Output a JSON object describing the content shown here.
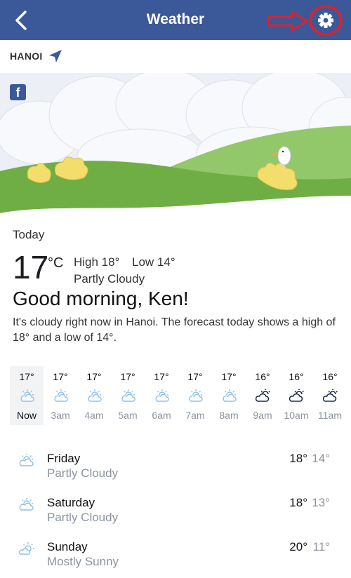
{
  "header": {
    "title": "Weather",
    "back_icon": "back-chevron-icon",
    "settings_icon": "gear-icon"
  },
  "location": {
    "name": "HANOI",
    "icon": "location-arrow-icon"
  },
  "current": {
    "label": "Today",
    "temp": "17",
    "unit": "°C",
    "high": "High 18°",
    "low": "Low 14°",
    "condition": "Partly Cloudy",
    "greeting": "Good morning, Ken!",
    "summary": "It's cloudy right now in Hanoi. The forecast today shows a high of 18° and a low of 14°."
  },
  "hourly": [
    {
      "temp": "17°",
      "label": "Now",
      "icon": "partly-cloudy-icon"
    },
    {
      "temp": "17°",
      "label": "3am",
      "icon": "partly-cloudy-icon"
    },
    {
      "temp": "17°",
      "label": "4am",
      "icon": "partly-cloudy-icon"
    },
    {
      "temp": "17°",
      "label": "5am",
      "icon": "partly-cloudy-icon"
    },
    {
      "temp": "17°",
      "label": "6am",
      "icon": "partly-cloudy-icon"
    },
    {
      "temp": "17°",
      "label": "7am",
      "icon": "partly-cloudy-icon"
    },
    {
      "temp": "17°",
      "label": "8am",
      "icon": "partly-cloudy-icon"
    },
    {
      "temp": "16°",
      "label": "9am",
      "icon": "cloudy-day-icon"
    },
    {
      "temp": "16°",
      "label": "10am",
      "icon": "cloudy-day-icon"
    },
    {
      "temp": "16°",
      "label": "11am",
      "icon": "cloudy-day-icon"
    }
  ],
  "daily": [
    {
      "day": "Friday",
      "condition": "Partly Cloudy",
      "high": "18°",
      "low": "14°",
      "icon": "partly-cloudy-icon"
    },
    {
      "day": "Saturday",
      "condition": "Partly Cloudy",
      "high": "18°",
      "low": "13°",
      "icon": "partly-cloudy-icon"
    },
    {
      "day": "Sunday",
      "condition": "Mostly Sunny",
      "high": "20°",
      "low": "11°",
      "icon": "mostly-sunny-icon"
    }
  ],
  "colors": {
    "header_bg": "#3b5998",
    "annotation": "#e0202a",
    "grass": "#7ab649",
    "icon_blue": "#8fbfe8"
  }
}
